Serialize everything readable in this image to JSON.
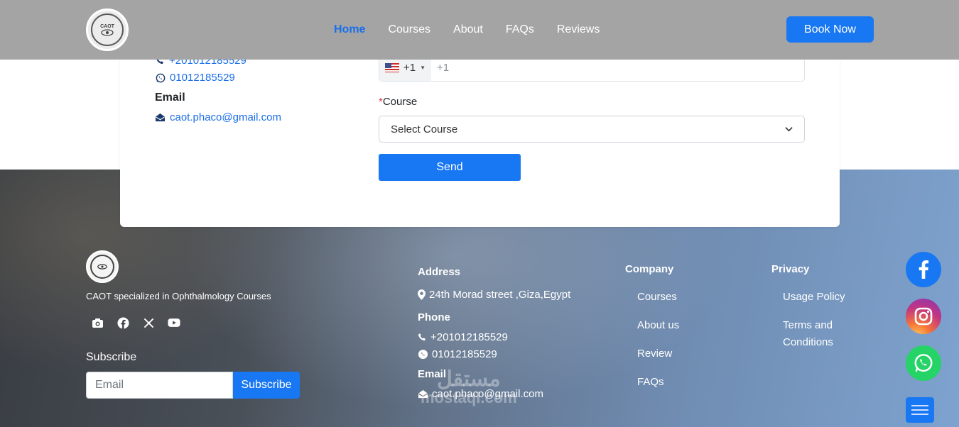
{
  "header": {
    "logo_text": "CAOT",
    "nav": [
      {
        "label": "Home",
        "active": true
      },
      {
        "label": "Courses",
        "active": false
      },
      {
        "label": "About",
        "active": false
      },
      {
        "label": "FAQs",
        "active": false
      },
      {
        "label": "Reviews",
        "active": false
      }
    ],
    "book_label": "Book Now"
  },
  "contact": {
    "phone": "+201012185529",
    "whatsapp": "01012185529",
    "email_heading": "Email",
    "email": "caot.phaco@gmail.com"
  },
  "form": {
    "dial_code": "+1",
    "phone_placeholder": "+1",
    "course_required_mark": "*",
    "course_label": "Course",
    "course_selected": "Select Course",
    "send_label": "Send"
  },
  "footer": {
    "tagline": "CAOT specialized in Ophthalmology Courses",
    "social_icons": [
      "camera-icon",
      "facebook-icon",
      "x-icon",
      "youtube-icon"
    ],
    "subscribe_label": "Subscribe",
    "email_placeholder": "Email",
    "subscribe_button": "Subscribe",
    "address_heading": "Address",
    "address": "24th Morad street ,Giza,Egypt",
    "phone_heading": "Phone",
    "phone": "+201012185529",
    "whatsapp": "01012185529",
    "email_heading": "Email",
    "email": "caot.phaco@gmail.com",
    "company_heading": "Company",
    "company_links": [
      "Courses",
      "About us",
      "Review",
      "FAQs"
    ],
    "privacy_heading": "Privacy",
    "privacy_links": [
      "Usage Policy",
      "Terms and Conditions"
    ],
    "watermark_ar": "مستقل",
    "watermark_en": "mostaql.com"
  },
  "floating": {
    "facebook_color": "#1877f2",
    "instagram_color": "#c13584",
    "whatsapp_color": "#25d366"
  },
  "colors": {
    "accent": "#1877f2",
    "header_bg": "#a4a4a4"
  }
}
